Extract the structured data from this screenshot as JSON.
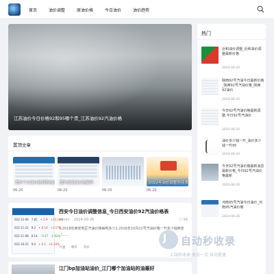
{
  "nav": {
    "items": [
      "首页",
      "油价调整",
      "原油价格",
      "今日油价",
      "油价趋势"
    ]
  },
  "slider": {
    "title": "江苏油价今日价格92和95哪个贵_江苏油价92汽油价格"
  },
  "recommended": {
    "title": "置顶文章",
    "cards": [
      {
        "caption": "重庆今日油价格调整信息",
        "date": "06-20"
      },
      {
        "caption": "国内成品油价格最新",
        "date": "06-20"
      },
      {
        "caption": "",
        "date": "06-20"
      },
      {
        "caption": "2022年油价调整时间表",
        "date": "06-20"
      }
    ]
  },
  "article": {
    "title": "西安今日油价调整信息_今日西安油价92汽油价格表",
    "author": "admin",
    "date": "2024-09-26",
    "count": "56",
    "excerpt": "1.2018年西安地区汽油价格每吨多少2.2016年10月21号汽油价格一升多少钱西安（……",
    "tags": [
      "汽油",
      "每升",
      "升价"
    ],
    "thumb_rows": [
      {
        "date": "022-12-06",
        "price": "7.85",
        "change": "+ 1.9",
        "pct": "+13.24%",
        "dir": "up"
      },
      {
        "date": "022-11-22",
        "price": "9.2",
        "change": "+ 0.14",
        "pct": "+1.57%",
        "dir": "up"
      },
      {
        "date": "022-11-08",
        "price": "8.14",
        "change": "- 0.17",
        "pct": "-1.92%",
        "dir": "dn"
      },
      {
        "date": "022-10-25",
        "price": "9.0",
        "change": "+ 0.1",
        "pct": "+1.54%",
        "dir": "up"
      }
    ]
  },
  "article2": {
    "title": "江门bp加油站油价_江门哪个加油站的油最好"
  },
  "sidebar": {
    "title": "热门",
    "items": [
      {
        "title": "近和油价调整_近和油价调整最新价格",
        "date": "2024-06-20"
      },
      {
        "title": "陕西92号汽油今日最新价格_陕西92号汽油价格_陕西92油价",
        "date": "2024-06-20"
      },
      {
        "title": "今日92号汽油价格最新调整,今日92号汽油价",
        "date": "2024-06-20"
      },
      {
        "title": "油价多少钱一升_油价多少钱一升95",
        "date": "2024-06-20"
      },
      {
        "title": "今天92号汽油价格最新消息最新价格_今日92号汽油价格最新",
        "date": "2024-06-20"
      },
      {
        "title": "河南95号汽油今日油价_河南95汽油价格",
        "date": "2024-06-20"
      }
    ]
  },
  "watermark": {
    "badge": "J",
    "name": "自动秒收录",
    "slogan": "上线秒收录·来访一次·自动提速"
  },
  "colors": {
    "accent": "#1a63a8",
    "price_up": "#d43c2b",
    "price_down": "#2d9b3a"
  }
}
